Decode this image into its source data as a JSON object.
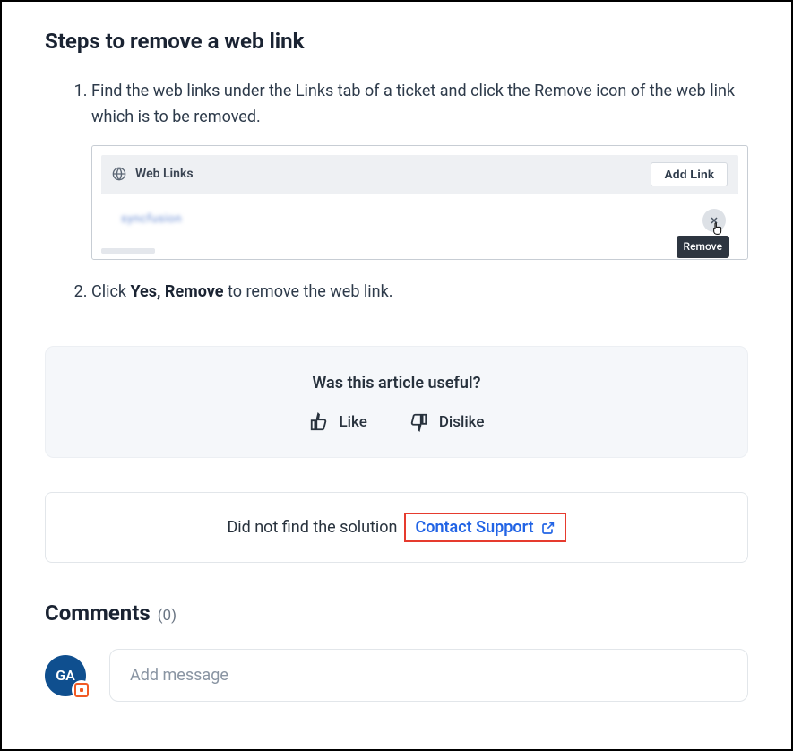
{
  "title": "Steps to remove a web link",
  "steps": {
    "s1": "Find the web links under the Links tab of a ticket and click the Remove icon of the web link which is to be removed.",
    "s2_pre": "Click ",
    "s2_strong": "Yes, Remove",
    "s2_post": " to remove the web link."
  },
  "screenshot": {
    "section_title": "Web Links",
    "add_link": "Add Link",
    "blurred_link": "syncfusion",
    "tooltip": "Remove"
  },
  "feedback": {
    "question": "Was this article useful?",
    "like": "Like",
    "dislike": "Dislike"
  },
  "support": {
    "prefix": "Did not find the solution",
    "contact": "Contact Support"
  },
  "comments": {
    "heading": "Comments",
    "count": "(0)",
    "avatar_initials": "GA",
    "placeholder": "Add message"
  }
}
